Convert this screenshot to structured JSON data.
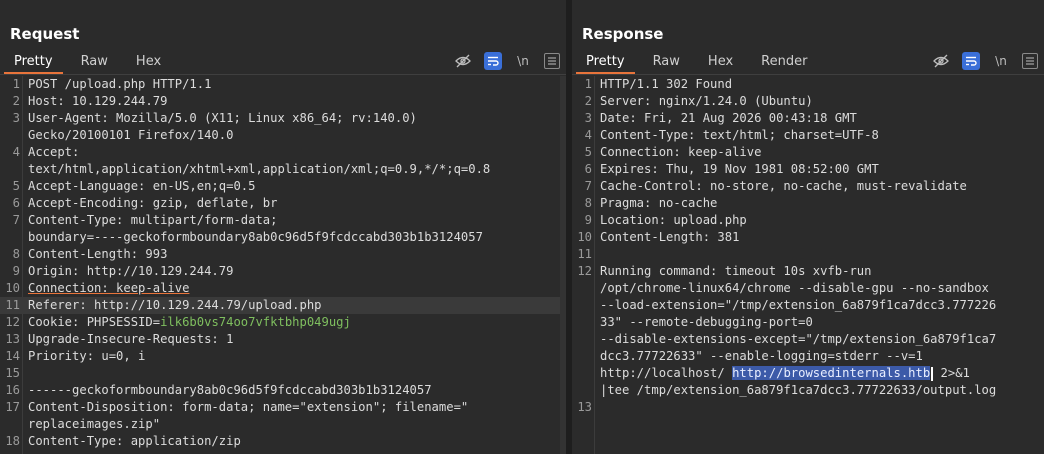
{
  "request": {
    "title": "Request",
    "tabs": [
      "Pretty",
      "Raw",
      "Hex"
    ],
    "active_tab": "Pretty",
    "tools": {
      "hide_icon": "eye-off-icon",
      "wrap_icon": "wrap-lines-icon",
      "newline_label": "\\n",
      "menu_icon": "menu-icon"
    },
    "lines": [
      {
        "n": "1",
        "segs": [
          {
            "t": "POST /upload.php HTTP/1.1"
          }
        ]
      },
      {
        "n": "2",
        "segs": [
          {
            "t": "Host: 10.129.244.79"
          }
        ]
      },
      {
        "n": "3",
        "segs": [
          {
            "t": "User-Agent: Mozilla/5.0 (X11; Linux x86_64; rv:140.0)"
          }
        ]
      },
      {
        "n": "",
        "segs": [
          {
            "t": "Gecko/20100101 Firefox/140.0"
          }
        ]
      },
      {
        "n": "4",
        "segs": [
          {
            "t": "Accept:"
          }
        ]
      },
      {
        "n": "",
        "segs": [
          {
            "t": "text/html,application/xhtml+xml,application/xml;q=0.9,*/*;q=0.8"
          }
        ]
      },
      {
        "n": "5",
        "segs": [
          {
            "t": "Accept-Language: en-US,en;q=0.5"
          }
        ]
      },
      {
        "n": "6",
        "segs": [
          {
            "t": "Accept-Encoding: gzip, deflate, br"
          }
        ]
      },
      {
        "n": "7",
        "segs": [
          {
            "t": "Content-Type: multipart/form-data;"
          }
        ]
      },
      {
        "n": "",
        "segs": [
          {
            "t": "boundary=----geckoformboundary8ab0c96d5f9fcdccabd303b1b3124057"
          }
        ]
      },
      {
        "n": "8",
        "segs": [
          {
            "t": "Content-Length: 993"
          }
        ]
      },
      {
        "n": "9",
        "segs": [
          {
            "t": "Origin: http://10.129.244.79"
          }
        ]
      },
      {
        "n": "10",
        "segs": [
          {
            "t": "Connection: keep-alive",
            "c": "ul"
          }
        ]
      },
      {
        "n": "11",
        "hl": true,
        "segs": [
          {
            "t": "Referer: http://10.129.244.79/upload.php"
          }
        ]
      },
      {
        "n": "12",
        "segs": [
          {
            "t": "Cookie: PHPSESSID="
          },
          {
            "t": "ilk6b0vs74oo7vfktbhp049ugj",
            "c": "ck"
          }
        ]
      },
      {
        "n": "13",
        "segs": [
          {
            "t": "Upgrade-Insecure-Requests: 1"
          }
        ]
      },
      {
        "n": "14",
        "segs": [
          {
            "t": "Priority: u=0, i"
          }
        ]
      },
      {
        "n": "15",
        "segs": [
          {
            "t": ""
          }
        ]
      },
      {
        "n": "16",
        "segs": [
          {
            "t": "------geckoformboundary8ab0c96d5f9fcdccabd303b1b3124057"
          }
        ]
      },
      {
        "n": "17",
        "segs": [
          {
            "t": "Content-Disposition: form-data; name=\"extension\"; filename=\""
          }
        ]
      },
      {
        "n": "",
        "segs": [
          {
            "t": "replaceimages.zip\""
          }
        ]
      },
      {
        "n": "18",
        "segs": [
          {
            "t": "Content-Type: application/zip"
          }
        ]
      }
    ]
  },
  "response": {
    "title": "Response",
    "tabs": [
      "Pretty",
      "Raw",
      "Hex",
      "Render"
    ],
    "active_tab": "Pretty",
    "tools": {
      "hide_icon": "eye-off-icon",
      "wrap_icon": "wrap-lines-icon",
      "newline_label": "\\n",
      "menu_icon": "menu-icon"
    },
    "lines": [
      {
        "n": "1",
        "segs": [
          {
            "t": "HTTP/1.1 302 Found"
          }
        ]
      },
      {
        "n": "2",
        "segs": [
          {
            "t": "Server: nginx/1.24.0 (Ubuntu)"
          }
        ]
      },
      {
        "n": "3",
        "segs": [
          {
            "t": "Date: Fri, 21 Aug 2026 00:43:18 GMT"
          }
        ]
      },
      {
        "n": "4",
        "segs": [
          {
            "t": "Content-Type: text/html; charset=UTF-8"
          }
        ]
      },
      {
        "n": "5",
        "segs": [
          {
            "t": "Connection: keep-alive"
          }
        ]
      },
      {
        "n": "6",
        "segs": [
          {
            "t": "Expires: Thu, 19 Nov 1981 08:52:00 GMT"
          }
        ]
      },
      {
        "n": "7",
        "segs": [
          {
            "t": "Cache-Control: no-store, no-cache, must-revalidate"
          }
        ]
      },
      {
        "n": "8",
        "segs": [
          {
            "t": "Pragma: no-cache"
          }
        ]
      },
      {
        "n": "9",
        "segs": [
          {
            "t": "Location: upload.php"
          }
        ]
      },
      {
        "n": "10",
        "segs": [
          {
            "t": "Content-Length: 381"
          }
        ]
      },
      {
        "n": "11",
        "segs": [
          {
            "t": ""
          }
        ]
      },
      {
        "n": "12",
        "segs": [
          {
            "t": "Running command: timeout 10s xvfb-run"
          }
        ]
      },
      {
        "n": "",
        "segs": [
          {
            "t": "/opt/chrome-linux64/chrome --disable-gpu --no-sandbox"
          }
        ]
      },
      {
        "n": "",
        "segs": [
          {
            "t": "--load-extension=\"/tmp/extension_6a879f1ca7dcc3.777226"
          }
        ]
      },
      {
        "n": "",
        "segs": [
          {
            "t": "33\" --remote-debugging-port=0"
          }
        ]
      },
      {
        "n": "",
        "segs": [
          {
            "t": "--disable-extensions-except=\"/tmp/extension_6a879f1ca7"
          }
        ]
      },
      {
        "n": "",
        "segs": [
          {
            "t": "dcc3.77722633\" --enable-logging=stderr --v=1"
          }
        ]
      },
      {
        "n": "",
        "segs": [
          {
            "t": "http://localhost/ "
          },
          {
            "t": "http://browsedinternals.htb",
            "c": "sel"
          },
          {
            "t": "",
            "c": "caret"
          },
          {
            "t": " 2>&1"
          }
        ]
      },
      {
        "n": "",
        "segs": [
          {
            "t": "|tee /tmp/extension_6a879f1ca7dcc3.77722633/output.log"
          }
        ]
      },
      {
        "n": "13",
        "segs": [
          {
            "t": ""
          }
        ]
      }
    ]
  },
  "layout_buttons": [
    "split-vertical-icon",
    "split-horizontal-icon",
    "single-pane-icon"
  ]
}
